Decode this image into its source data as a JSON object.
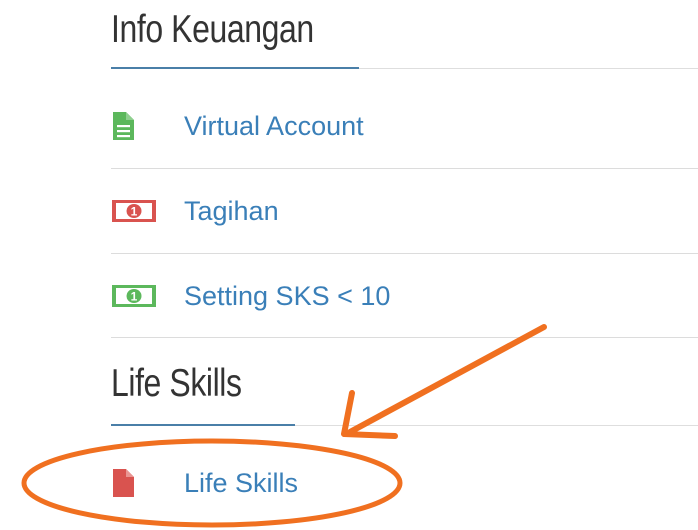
{
  "sections": [
    {
      "title": "Info Keuangan",
      "items": [
        {
          "label": "Virtual Account",
          "icon": "file-icon",
          "icon_color": "#5cb85c"
        },
        {
          "label": "Tagihan",
          "icon": "money-icon",
          "icon_color": "#d9534f"
        },
        {
          "label": "Setting SKS < 10",
          "icon": "money-icon",
          "icon_color": "#5cb85c"
        }
      ]
    },
    {
      "title": "Life Skills",
      "items": [
        {
          "label": "Life Skills",
          "icon": "file-icon",
          "icon_color": "#d9534f"
        }
      ]
    }
  ],
  "colors": {
    "link": "#3a7fb8",
    "heading": "#333333",
    "accent_underline": "#4a7fa8",
    "annotation": "#f07020"
  }
}
